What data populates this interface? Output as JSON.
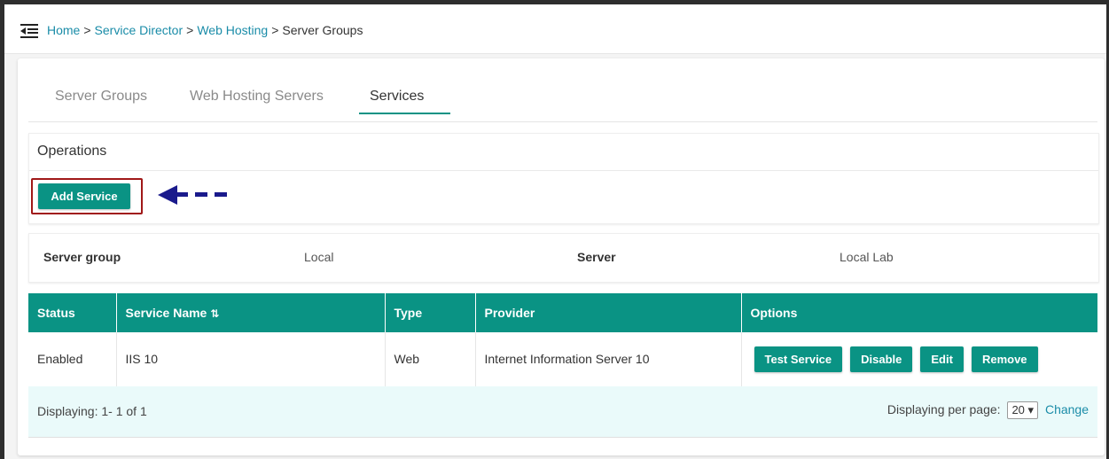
{
  "breadcrumb": {
    "home": "Home",
    "service_director": "Service Director",
    "web_hosting": "Web Hosting",
    "current": "Server Groups",
    "separator": ">"
  },
  "tabs": [
    {
      "label": "Server Groups",
      "active": false
    },
    {
      "label": "Web Hosting Servers",
      "active": false
    },
    {
      "label": "Services",
      "active": true
    }
  ],
  "operations": {
    "title": "Operations",
    "add_service_label": "Add Service"
  },
  "info": {
    "server_group_label": "Server group",
    "server_group_value": "Local",
    "server_label": "Server",
    "server_value": "Local Lab"
  },
  "table": {
    "columns": [
      "Status",
      "Service Name",
      "Type",
      "Provider",
      "Options"
    ],
    "sort_icon": "sort-icon",
    "rows": [
      {
        "status": "Enabled",
        "service_name": "IIS 10",
        "type": "Web",
        "provider": "Internet Information Server 10",
        "options": [
          "Test Service",
          "Disable",
          "Edit",
          "Remove"
        ]
      }
    ]
  },
  "footer": {
    "displaying": "Displaying: 1- 1 of 1",
    "per_page_label": "Displaying per page:",
    "per_page_value": "20",
    "change_label": "Change"
  },
  "colors": {
    "accent": "#0a9384",
    "link": "#1a8ca8",
    "highlight": "#a01818",
    "arrow": "#1a1a8c",
    "footer_bg": "#eafafa"
  }
}
